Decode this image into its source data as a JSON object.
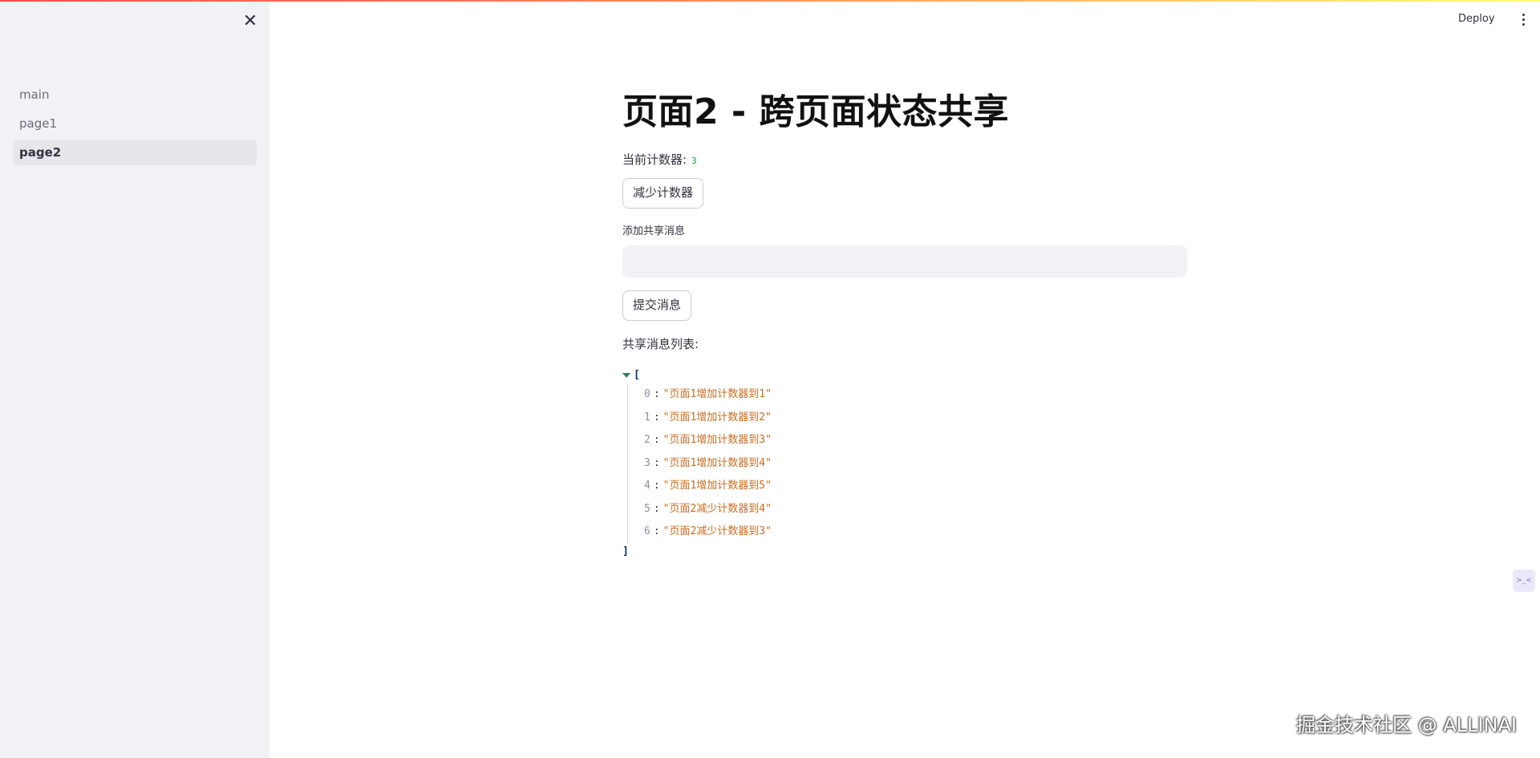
{
  "sidebar": {
    "items": [
      {
        "label": "main"
      },
      {
        "label": "page1"
      },
      {
        "label": "page2"
      }
    ]
  },
  "header": {
    "deploy_label": "Deploy"
  },
  "main": {
    "title": "页面2 - 跨页面状态共享",
    "counter_label": "当前计数器:",
    "counter_value": "3",
    "decrement_button": "减少计数器",
    "input_label": "添加共享消息",
    "input_value": "",
    "submit_button": "提交消息",
    "list_title": "共享消息列表:",
    "json_open": "[",
    "json_close": "]",
    "messages": [
      {
        "index": "0",
        "text": "\"页面1增加计数器到1\""
      },
      {
        "index": "1",
        "text": "\"页面1增加计数器到2\""
      },
      {
        "index": "2",
        "text": "\"页面1增加计数器到3\""
      },
      {
        "index": "3",
        "text": "\"页面1增加计数器到4\""
      },
      {
        "index": "4",
        "text": "\"页面1增加计数器到5\""
      },
      {
        "index": "5",
        "text": "\"页面2减少计数器到4\""
      },
      {
        "index": "6",
        "text": "\"页面2减少计数器到3\""
      }
    ]
  },
  "watermark": "掘金技术社区 @ ALLINAI",
  "colors": {
    "accent": "#ff4b4b",
    "sidebar_bg": "#f0f2f6",
    "json_string": "#cb6b21",
    "counter_value": "#09ab3b"
  }
}
